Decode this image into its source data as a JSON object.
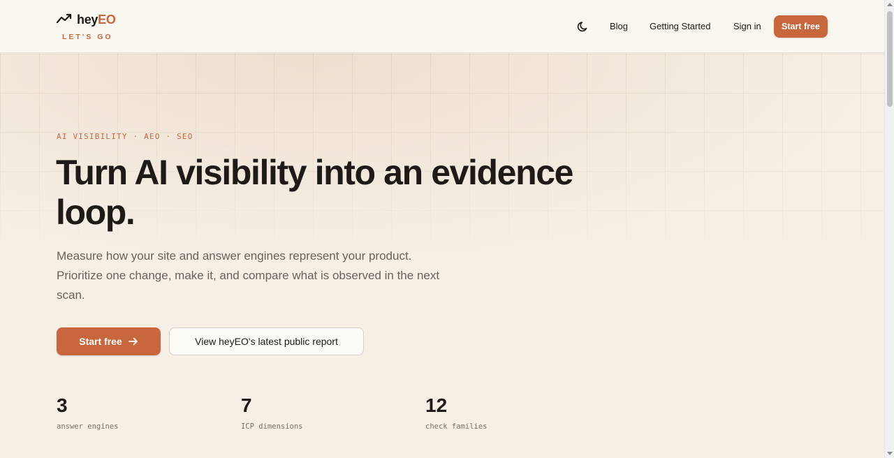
{
  "brand": {
    "name_main": "hey",
    "name_accent": "EO",
    "tagline": "LET'S GO",
    "logo_icon": "trend-line-icon",
    "accent_color": "#c8663d"
  },
  "nav": {
    "theme_toggle_icon": "moon-icon",
    "links": [
      "Blog",
      "Getting Started",
      "Sign in"
    ],
    "cta_label": "Start free"
  },
  "hero": {
    "eyebrow": "AI VISIBILITY · AEO · SEO",
    "headline": "Turn AI visibility into an evidence loop.",
    "lead": "Measure how your site and answer engines represent your product. Prioritize one change, make it, and compare what is observed in the next scan.",
    "primary_button": "Start free",
    "primary_button_icon": "arrow-right-icon",
    "secondary_button": "View heyEO's latest public report"
  },
  "stats": [
    {
      "value": "3",
      "label": "answer engines"
    },
    {
      "value": "7",
      "label": "ICP dimensions"
    },
    {
      "value": "12",
      "label": "check families"
    }
  ]
}
